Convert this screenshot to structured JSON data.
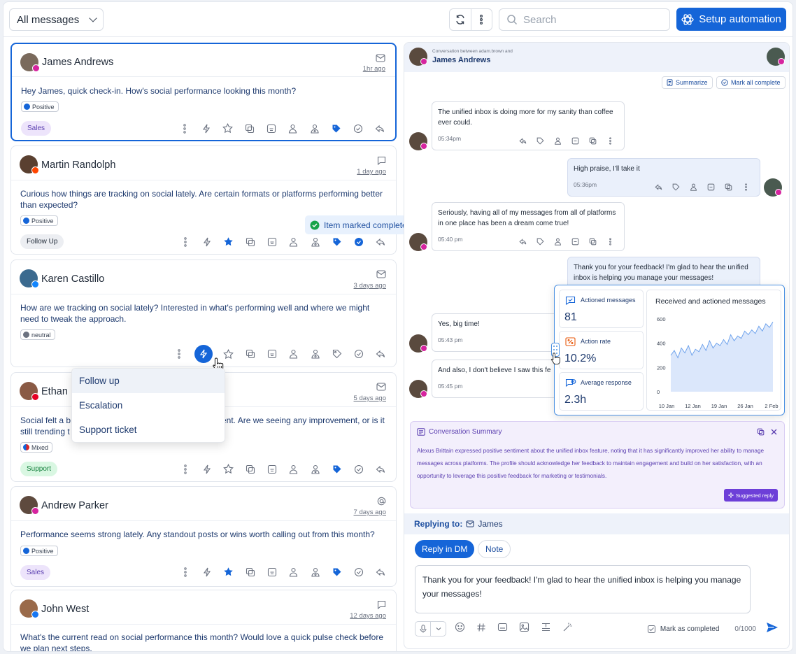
{
  "toolbar": {
    "filter_label": "All messages",
    "search_placeholder": "Search",
    "setup_label": "Setup automation"
  },
  "messages": [
    {
      "sender": "James Andrews",
      "time": "1hr ago",
      "text": "Hey James, quick check-in. How's social performance looking this month?",
      "sentiment": "Positive",
      "tag": "Sales",
      "channel": "instagram"
    },
    {
      "sender": "Martin Randolph",
      "time": "1 day ago",
      "text": "Curious how things are tracking on social lately. Are certain formats or platforms performing better than expected?",
      "sentiment": "Positive",
      "tag": "Follow Up",
      "channel": "reddit"
    },
    {
      "sender": "Karen Castillo",
      "time": "3 days ago",
      "text": "How are we tracking on social lately? Interested in what's performing well and where we might need to tweak the approach.",
      "sentiment": "neutral",
      "tag": "",
      "channel": "bluesky"
    },
    {
      "sender": "Ethan",
      "time": "5 days ago",
      "text_left": "Social felt a b",
      "text_right": "ent. Are we seeing any improvement, or is it",
      "text_line2": "still trending t",
      "sentiment": "Mixed",
      "tag": "Support",
      "channel": "pinterest"
    },
    {
      "sender": "Andrew Parker",
      "time": "7 days ago",
      "text": "Performance seems strong lately. Any standout posts or wins worth calling out from this month?",
      "sentiment": "Positive",
      "tag": "Sales",
      "channel": "instagram"
    },
    {
      "sender": "John West",
      "time": "12 days ago",
      "text": "What's the current read on social performance this month? Would love a quick pulse check before we plan next steps.",
      "channel": "facebook"
    }
  ],
  "toast": "Item marked completed",
  "dropdown": [
    "Follow up",
    "Escalation",
    "Support ticket"
  ],
  "conversation": {
    "between": "Conversation between adam.brown and",
    "name": "James Andrews",
    "summarize": "Summarize",
    "mark_all": "Mark all complete",
    "bubbles": [
      {
        "text": "The unified inbox is doing more for my sanity than coffee ever could.",
        "time": "05:34pm"
      },
      {
        "text": "High praise, I'll take it",
        "time": "05:36pm"
      },
      {
        "text": "Seriously, having all of my messages from all of platforms in one place has been a dream come true!",
        "time": "05:40 pm"
      },
      {
        "text": "Thank you for your feedback! I'm glad to hear the unified inbox is helping you manage your messages!",
        "time": ""
      },
      {
        "text": "Yes, big time!",
        "time": "05:43 pm"
      },
      {
        "text": "And also, I don't believe I saw this fe",
        "time": "05:45 pm"
      }
    ]
  },
  "stats": {
    "actioned_label": "Actioned messages",
    "actioned_value": "81",
    "rate_label": "Action rate",
    "rate_value": "10.2%",
    "response_label": "Average response",
    "response_value": "2.3h"
  },
  "chart_data": {
    "type": "area",
    "title": "Received and actioned messages",
    "x_ticks": [
      "10 Jan",
      "12 Jan",
      "19 Jan",
      "26 Jan",
      "2 Feb"
    ],
    "y_ticks": [
      0,
      200,
      400,
      600
    ],
    "ylim": [
      0,
      600
    ],
    "values": [
      300,
      340,
      280,
      360,
      320,
      380,
      300,
      350,
      330,
      390,
      340,
      420,
      360,
      400,
      380,
      430,
      390,
      470,
      420,
      460,
      440,
      500,
      470,
      510,
      480,
      540,
      500,
      560,
      530,
      575
    ]
  },
  "summary": {
    "title": "Conversation Summary",
    "text": "Alexus Brittain expressed positive sentiment about the unified inbox feature, noting that it has significantly improved her ability to manage messages across platforms. The profile should acknowledge her feedback to maintain engagement and build on her satisfaction, with an opportunity to leverage this positive feedback for marketing or testimonials.",
    "suggested": "Suggested reply"
  },
  "reply": {
    "label": "Replying to:",
    "to": "James",
    "tab_dm": "Reply in DM",
    "tab_note": "Note",
    "text": "Thank you for your feedback! I'm glad to hear the unified inbox is helping you manage your messages!",
    "mark_completed": "Mark as completed",
    "counter": "0/1000"
  },
  "colors": {
    "accent": "#1565d8",
    "summary_bg": "#f3effc"
  }
}
